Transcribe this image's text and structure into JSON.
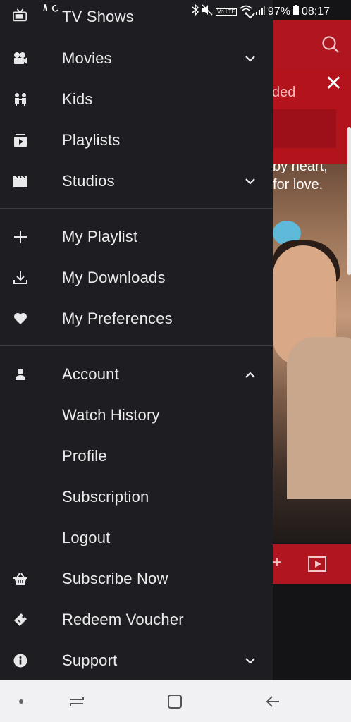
{
  "status_bar": {
    "battery": "97%",
    "time": "08:17"
  },
  "drawer": {
    "items": [
      {
        "label": "TV Shows",
        "icon": "tv-icon",
        "chevron": "down"
      },
      {
        "label": "Movies",
        "icon": "film-camera-icon",
        "chevron": "down"
      },
      {
        "label": "Kids",
        "icon": "kids-icon",
        "chevron": ""
      },
      {
        "label": "Playlists",
        "icon": "playlist-icon",
        "chevron": ""
      },
      {
        "label": "Studios",
        "icon": "clapperboard-icon",
        "chevron": "down"
      },
      {
        "label": "My Playlist",
        "icon": "plus-icon",
        "chevron": ""
      },
      {
        "label": "My Downloads",
        "icon": "download-icon",
        "chevron": ""
      },
      {
        "label": "My Preferences",
        "icon": "heart-icon",
        "chevron": ""
      },
      {
        "label": "Account",
        "icon": "user-icon",
        "chevron": "up"
      },
      {
        "label": "Watch History",
        "icon": "",
        "chevron": ""
      },
      {
        "label": "Profile",
        "icon": "",
        "chevron": ""
      },
      {
        "label": "Subscription",
        "icon": "",
        "chevron": ""
      },
      {
        "label": "Logout",
        "icon": "",
        "chevron": ""
      },
      {
        "label": "Subscribe Now",
        "icon": "basket-icon",
        "chevron": ""
      },
      {
        "label": "Redeem Voucher",
        "icon": "voucher-icon",
        "chevron": ""
      },
      {
        "label": "Support",
        "icon": "info-icon",
        "chevron": "down"
      }
    ]
  },
  "background": {
    "banner_text": "ded",
    "photo_text_line1": "by heart,",
    "photo_text_line2": "for love."
  },
  "colors": {
    "drawer_bg": "#1e1e22",
    "brand_red": "#b0161f",
    "text": "#ececee"
  }
}
